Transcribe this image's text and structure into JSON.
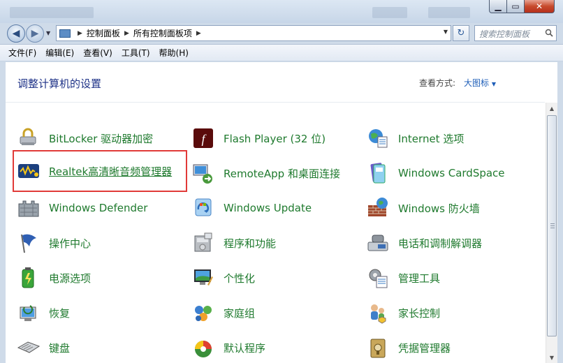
{
  "address": {
    "segments": [
      "控制面板",
      "所有控制面板项"
    ]
  },
  "search": {
    "placeholder": "搜索控制面板"
  },
  "menu": [
    "文件(F)",
    "编辑(E)",
    "查看(V)",
    "工具(T)",
    "帮助(H)"
  ],
  "content": {
    "title": "调整计算机的设置",
    "view_by_label": "查看方式:",
    "view_mode": "大图标",
    "items": [
      {
        "label": "BitLocker 驱动器加密",
        "icon": "bitlocker-icon"
      },
      {
        "label": "Flash Player (32 位)",
        "icon": "flash-icon"
      },
      {
        "label": "Internet 选项",
        "icon": "internet-options-icon"
      },
      {
        "label": "Realtek高清晰音频管理器",
        "icon": "realtek-audio-icon"
      },
      {
        "label": "RemoteApp 和桌面连接",
        "icon": "remoteapp-icon"
      },
      {
        "label": "Windows CardSpace",
        "icon": "cardspace-icon"
      },
      {
        "label": "Windows Defender",
        "icon": "defender-icon"
      },
      {
        "label": "Windows Update",
        "icon": "windows-update-icon"
      },
      {
        "label": "Windows 防火墙",
        "icon": "firewall-icon"
      },
      {
        "label": "操作中心",
        "icon": "action-center-flag-icon"
      },
      {
        "label": "程序和功能",
        "icon": "programs-icon"
      },
      {
        "label": "电话和调制解调器",
        "icon": "phone-modem-icon"
      },
      {
        "label": "电源选项",
        "icon": "power-icon"
      },
      {
        "label": "个性化",
        "icon": "personalization-icon"
      },
      {
        "label": "管理工具",
        "icon": "admin-tools-icon"
      },
      {
        "label": "恢复",
        "icon": "recovery-icon"
      },
      {
        "label": "家庭组",
        "icon": "homegroup-icon"
      },
      {
        "label": "家长控制",
        "icon": "parental-controls-icon"
      },
      {
        "label": "键盘",
        "icon": "keyboard-icon"
      },
      {
        "label": "默认程序",
        "icon": "default-programs-icon"
      },
      {
        "label": "凭据管理器",
        "icon": "credential-manager-icon"
      }
    ]
  },
  "colors": {
    "link_green": "#1f7a2e",
    "title_blue": "#1e3287",
    "highlight_red": "#e13a38"
  }
}
